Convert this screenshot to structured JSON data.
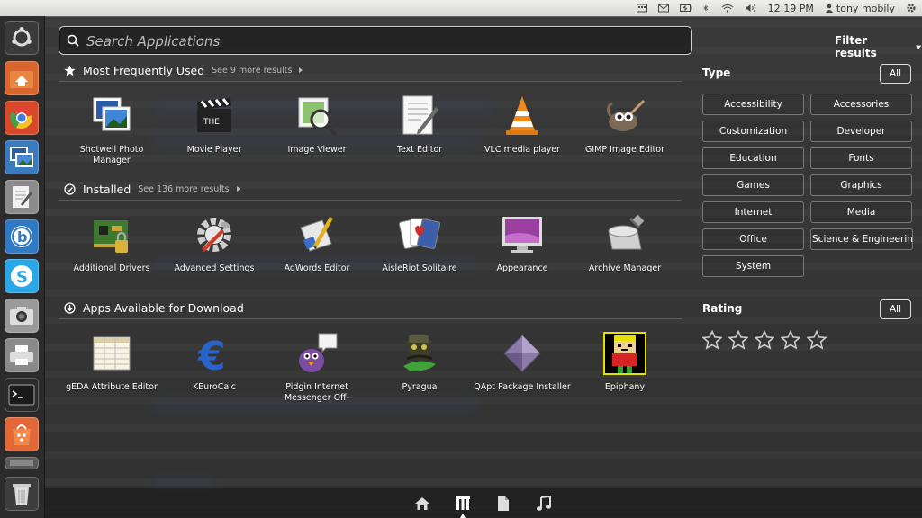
{
  "top_panel": {
    "time": "12:19 PM",
    "user": "tony mobily"
  },
  "search": {
    "placeholder": "Search Applications"
  },
  "categories": [
    {
      "title": "Most Frequently Used",
      "more": "See 9 more results",
      "apps": [
        {
          "label": "Shotwell Photo Manager",
          "icon": "shotwell-icon"
        },
        {
          "label": "Movie Player",
          "icon": "clapperboard-icon"
        },
        {
          "label": "Image Viewer",
          "icon": "image-viewer-icon"
        },
        {
          "label": "Text Editor",
          "icon": "text-editor-icon"
        },
        {
          "label": "VLC media player",
          "icon": "vlc-cone-icon"
        },
        {
          "label": "GIMP Image Editor",
          "icon": "gimp-icon"
        }
      ]
    },
    {
      "title": "Installed",
      "more": "See 136 more results",
      "apps": [
        {
          "label": "Additional Drivers",
          "icon": "drivers-icon"
        },
        {
          "label": "Advanced Settings",
          "icon": "settings-gear-icon"
        },
        {
          "label": "AdWords Editor",
          "icon": "adwords-icon"
        },
        {
          "label": "AisleRiot Solitaire",
          "icon": "playing-cards-icon"
        },
        {
          "label": "Appearance",
          "icon": "monitor-icon"
        },
        {
          "label": "Archive Manager",
          "icon": "archive-icon"
        }
      ]
    },
    {
      "title": "Apps Available for Download",
      "more": "",
      "apps": [
        {
          "label": "gEDA Attribute Editor",
          "icon": "spreadsheet-icon"
        },
        {
          "label": "KEuroCalc",
          "icon": "euro-icon"
        },
        {
          "label": "Pidgin Internet Messenger Off-",
          "icon": "pidgin-icon"
        },
        {
          "label": "Pyragua",
          "icon": "pyragua-icon"
        },
        {
          "label": "QApt Package Installer",
          "icon": "package-icon"
        },
        {
          "label": "Epiphany",
          "icon": "epiphany-icon"
        }
      ]
    }
  ],
  "filters": {
    "title": "Filter results",
    "type_title": "Type",
    "type_all": "All",
    "types": [
      "Accessibility",
      "Accessories",
      "Customization",
      "Developer",
      "Education",
      "Fonts",
      "Games",
      "Graphics",
      "Internet",
      "Media",
      "Office",
      "Science & Engineering",
      "System"
    ],
    "rating_title": "Rating",
    "rating_all": "All",
    "rating_stars": 5
  },
  "launcher_icons": [
    "ubuntu-logo-icon",
    "home-folder-icon",
    "chrome-icon",
    "shotwell-icon",
    "text-editor-icon",
    "bluetooth-b-icon",
    "skype-icon",
    "camera-icon",
    "printer-icon",
    "terminal-icon",
    "software-center-icon",
    "workspace-icon",
    "trash-icon"
  ],
  "lenses": [
    "home-icon",
    "applications-icon",
    "files-icon",
    "music-icon"
  ]
}
